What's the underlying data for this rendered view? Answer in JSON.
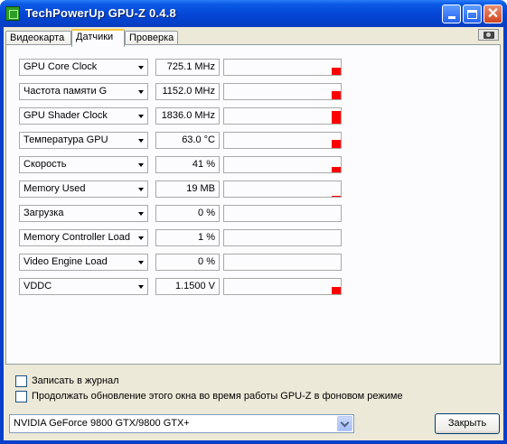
{
  "window": {
    "title": "TechPowerUp GPU-Z 0.4.8"
  },
  "tabs": [
    {
      "label": "Видеокарта",
      "active": false
    },
    {
      "label": "Датчики",
      "active": true
    },
    {
      "label": "Проверка",
      "active": false
    }
  ],
  "sensors": [
    {
      "name": "GPU Core Clock",
      "value": "725.1 MHz",
      "graph_level": 0.45
    },
    {
      "name": "Частота памяти G",
      "value": "1152.0 MHz",
      "graph_level": 0.5
    },
    {
      "name": "GPU Shader Clock",
      "value": "1836.0 MHz",
      "graph_level": 0.85
    },
    {
      "name": "Температура GPU",
      "value": "63.0 °C",
      "graph_level": 0.5
    },
    {
      "name": "Скорость",
      "value": "41 %",
      "graph_level": 0.35
    },
    {
      "name": "Memory Used",
      "value": "19 MB",
      "graph_level": 0.05
    },
    {
      "name": "Загрузка",
      "value": "0 %",
      "graph_level": 0
    },
    {
      "name": "Memory Controller Load",
      "value": "1 %",
      "graph_level": 0
    },
    {
      "name": "Video Engine Load",
      "value": "0 %",
      "graph_level": 0
    },
    {
      "name": "VDDC",
      "value": "1.1500 V",
      "graph_level": 0.45
    }
  ],
  "options": {
    "log_label": "Записать в журнал",
    "log_checked": false,
    "continue_label": "Продолжать обновление этого окна во время работы GPU-Z в фоновом режиме",
    "continue_checked": false
  },
  "footer": {
    "gpu_selected": "NVIDIA GeForce 9800 GTX/9800 GTX+",
    "close_label": "Закрыть"
  },
  "colors": {
    "graph_bar": "#ff0000",
    "titlebar": "#0545d6"
  }
}
